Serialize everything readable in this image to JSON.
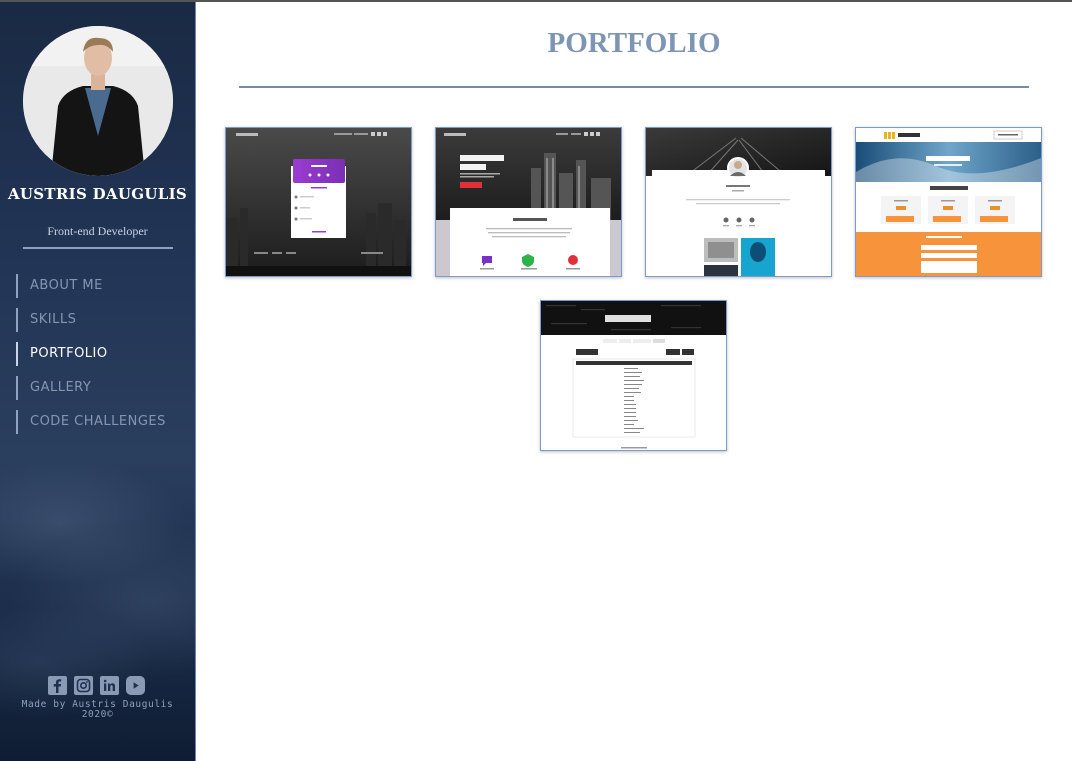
{
  "profile": {
    "name": "AUSTRIS DAUGULIS",
    "role": "Front-end Developer"
  },
  "nav": [
    {
      "label": "ABOUT ME",
      "active": false
    },
    {
      "label": "SKILLS",
      "active": false
    },
    {
      "label": "PORTFOLIO",
      "active": true
    },
    {
      "label": "GALLERY",
      "active": false
    },
    {
      "label": "CODE CHALLENGES",
      "active": false
    }
  ],
  "socials": [
    "facebook-icon",
    "instagram-icon",
    "linkedin-icon",
    "youtube-icon"
  ],
  "footer": {
    "line1": "Made by Austris Daugulis",
    "line2": "2020©"
  },
  "page": {
    "title": "PORTFOLIO"
  },
  "portfolio": {
    "items": [
      {
        "name": "sign-in-page"
      },
      {
        "name": "landing-page",
        "headline": "Write the best title for your page"
      },
      {
        "name": "profile-page"
      },
      {
        "name": "banking-page",
        "brand": "UEEKER"
      },
      {
        "name": "todo-list-app",
        "headline": "TO DO LIST"
      }
    ]
  },
  "colors": {
    "sidebar_bg": "#223556",
    "accent": "#7d95b5",
    "nav_text": "#8596b0"
  }
}
